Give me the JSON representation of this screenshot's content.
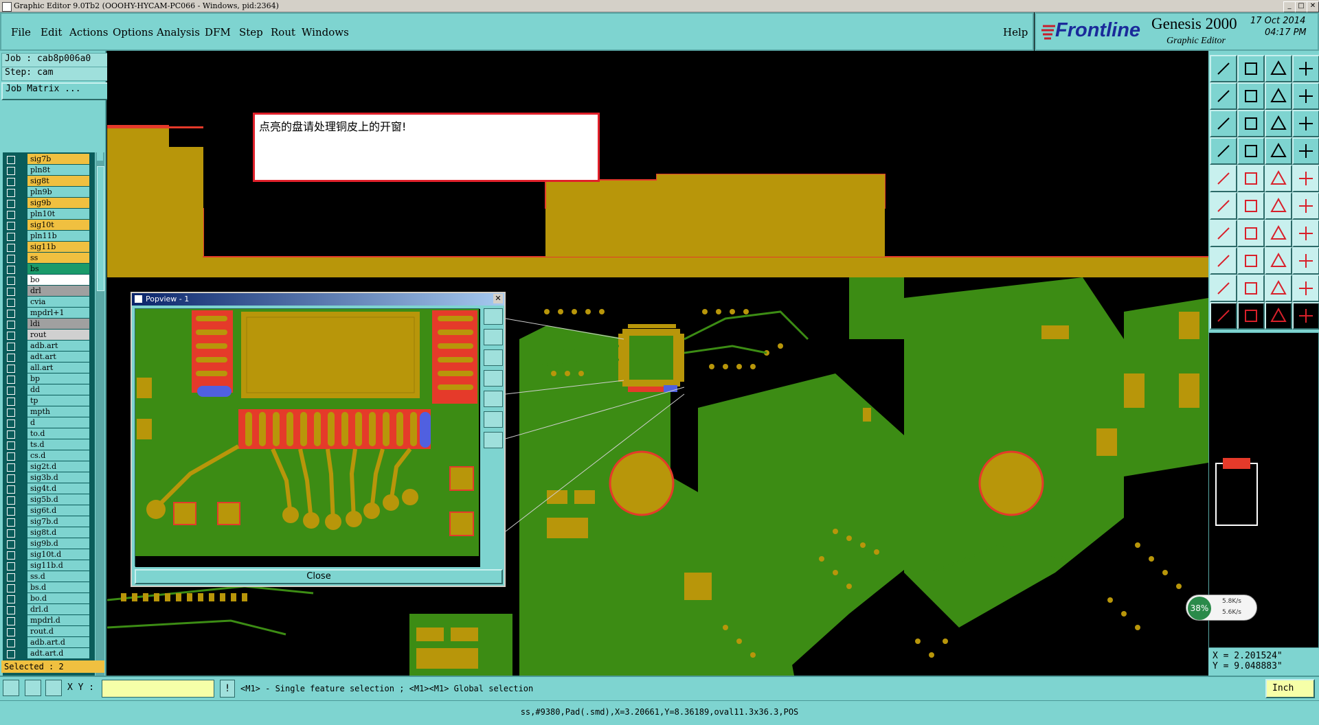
{
  "window": {
    "title": "Graphic Editor 9.0Tb2 (OOOHY-HYCAM-PC066 - Windows, pid:2364)"
  },
  "menu": {
    "items": [
      "File",
      "Edit",
      "Actions",
      "Options",
      "Analysis",
      "DFM",
      "Step",
      "Rout",
      "Windows"
    ],
    "help": "Help"
  },
  "brand": {
    "logo": "Frontline",
    "product": "Genesis 2000",
    "subtitle": "Graphic Editor",
    "date": "17 Oct 2014",
    "time": "04:17 PM"
  },
  "job": {
    "job_label": "Job : cab8p006a0",
    "step_label": "Step: cam",
    "job_matrix_button": "Job Matrix ..."
  },
  "layers": [
    {
      "name": "sig7b",
      "color": "#f0c040"
    },
    {
      "name": "pln8t",
      "color": "#7ed4d0"
    },
    {
      "name": "sig8t",
      "color": "#f0c040"
    },
    {
      "name": "pln9b",
      "color": "#7ed4d0"
    },
    {
      "name": "sig9b",
      "color": "#f0c040"
    },
    {
      "name": "pln10t",
      "color": "#7ed4d0"
    },
    {
      "name": "sig10t",
      "color": "#f0c040"
    },
    {
      "name": "pln11b",
      "color": "#7ed4d0"
    },
    {
      "name": "sig11b",
      "color": "#f0c040"
    },
    {
      "name": "ss",
      "color": "#f0c040"
    },
    {
      "name": "bs",
      "color": "#1a9a6a"
    },
    {
      "name": "bo",
      "color": "#ffffff"
    },
    {
      "name": "drl",
      "color": "#a0a0a0"
    },
    {
      "name": "cvia",
      "color": "#7ed4d0"
    },
    {
      "name": "mpdrl+1",
      "color": "#7ed4d0"
    },
    {
      "name": "ldi",
      "color": "#a0a0a0"
    },
    {
      "name": "rout",
      "color": "#d0d0d0"
    },
    {
      "name": "adb.art",
      "color": "#7ed4d0"
    },
    {
      "name": "adt.art",
      "color": "#7ed4d0"
    },
    {
      "name": "all.art",
      "color": "#7ed4d0"
    },
    {
      "name": "bp",
      "color": "#7ed4d0"
    },
    {
      "name": "dd",
      "color": "#7ed4d0"
    },
    {
      "name": "tp",
      "color": "#7ed4d0"
    },
    {
      "name": "mpth",
      "color": "#7ed4d0"
    },
    {
      "name": "d",
      "color": "#7ed4d0"
    },
    {
      "name": "to.d",
      "color": "#7ed4d0"
    },
    {
      "name": "ts.d",
      "color": "#7ed4d0"
    },
    {
      "name": "cs.d",
      "color": "#7ed4d0"
    },
    {
      "name": "sig2t.d",
      "color": "#7ed4d0"
    },
    {
      "name": "sig3b.d",
      "color": "#7ed4d0"
    },
    {
      "name": "sig4t.d",
      "color": "#7ed4d0"
    },
    {
      "name": "sig5b.d",
      "color": "#7ed4d0"
    },
    {
      "name": "sig6t.d",
      "color": "#7ed4d0"
    },
    {
      "name": "sig7b.d",
      "color": "#7ed4d0"
    },
    {
      "name": "sig8t.d",
      "color": "#7ed4d0"
    },
    {
      "name": "sig9b.d",
      "color": "#7ed4d0"
    },
    {
      "name": "sig10t.d",
      "color": "#7ed4d0"
    },
    {
      "name": "sig11b.d",
      "color": "#7ed4d0"
    },
    {
      "name": "ss.d",
      "color": "#7ed4d0"
    },
    {
      "name": "bs.d",
      "color": "#7ed4d0"
    },
    {
      "name": "bo.d",
      "color": "#7ed4d0"
    },
    {
      "name": "drl.d",
      "color": "#7ed4d0"
    },
    {
      "name": "mpdrl.d",
      "color": "#7ed4d0"
    },
    {
      "name": "rout.d",
      "color": "#7ed4d0"
    },
    {
      "name": "adb.art.d",
      "color": "#7ed4d0"
    },
    {
      "name": "adt.art.d",
      "color": "#7ed4d0"
    }
  ],
  "selected": "Selected : 2",
  "message": "点亮的盘请处理铜皮上的开窗!",
  "popview": {
    "title": "Popview - 1",
    "close": "Close"
  },
  "coords": {
    "x": "X = 2.201524\"",
    "y": "Y = 9.048883\""
  },
  "network": {
    "percent": "38%",
    "up": "5.8K/s",
    "down": "5.6K/s"
  },
  "toolrow": {
    "xy_label": "X Y :",
    "xy_value": "",
    "hint": "<M1> - Single feature selection ; <M1><M1> Global selection",
    "units": "Inch"
  },
  "status": "ss,#9380,Pad(.smd),X=3.20661,Y=8.36189,oval11.3x36.3,POS",
  "colors": {
    "panel": "#7ed4d0",
    "copper": "#b8960a",
    "board": "#3c8c14",
    "pad": "#e53a2a",
    "highlight": "#5060e0"
  }
}
